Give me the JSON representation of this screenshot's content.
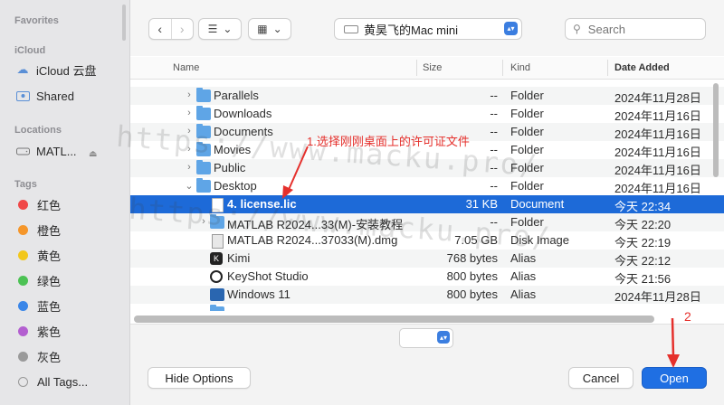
{
  "sidebar": {
    "favorites_heading": "Favorites",
    "icloud_heading": "iCloud",
    "icloud_items": [
      {
        "label": "iCloud 云盘",
        "icon": "cloud-icon"
      },
      {
        "label": "Shared",
        "icon": "shared-folder-icon"
      }
    ],
    "locations_heading": "Locations",
    "location_items": [
      {
        "label": "MATL...",
        "icon": "disk-icon"
      }
    ],
    "tags_heading": "Tags",
    "tags": [
      {
        "label": "红色",
        "color": "#f04848"
      },
      {
        "label": "橙色",
        "color": "#f5962a"
      },
      {
        "label": "黄色",
        "color": "#f2c71b"
      },
      {
        "label": "绿色",
        "color": "#4cc254"
      },
      {
        "label": "蓝色",
        "color": "#3a86e8"
      },
      {
        "label": "紫色",
        "color": "#b35fd0"
      },
      {
        "label": "灰色",
        "color": "#9a9a9a"
      }
    ],
    "all_tags_label": "All Tags..."
  },
  "toolbar": {
    "back_glyph": "‹",
    "forward_glyph": "›",
    "list_view_glyph": "☰",
    "grid_view_glyph": "▦",
    "dropdown_glyph": "⌄",
    "location_label": "黄昊飞的Mac mini",
    "search_placeholder": "Search"
  },
  "columns": {
    "name": "Name",
    "size": "Size",
    "kind": "Kind",
    "date_added": "Date Added"
  },
  "rows": [
    {
      "name": "Parallels",
      "size": "--",
      "kind": "Folder",
      "date": "2024年11月28日",
      "level": 1,
      "icon": "folder-icon",
      "expandable": true,
      "expanded": false
    },
    {
      "name": "Downloads",
      "size": "--",
      "kind": "Folder",
      "date": "2024年11月16日",
      "level": 1,
      "icon": "folder-icon",
      "expandable": true,
      "expanded": false
    },
    {
      "name": "Documents",
      "size": "--",
      "kind": "Folder",
      "date": "2024年11月16日",
      "level": 1,
      "icon": "folder-icon",
      "expandable": true,
      "expanded": false
    },
    {
      "name": "Movies",
      "size": "--",
      "kind": "Folder",
      "date": "2024年11月16日",
      "level": 1,
      "icon": "folder-icon",
      "expandable": true,
      "expanded": false
    },
    {
      "name": "Public",
      "size": "--",
      "kind": "Folder",
      "date": "2024年11月16日",
      "level": 1,
      "icon": "folder-icon",
      "expandable": true,
      "expanded": false
    },
    {
      "name": "Desktop",
      "size": "--",
      "kind": "Folder",
      "date": "2024年11月16日",
      "level": 1,
      "icon": "folder-icon",
      "expandable": true,
      "expanded": true
    },
    {
      "name": "4. license.lic",
      "size": "31 KB",
      "kind": "Document",
      "date": "今天 22:34",
      "level": 2,
      "icon": "document-icon",
      "expandable": false,
      "selected": true
    },
    {
      "name": "MATLAB R2024...33(M)-安装教程",
      "size": "--",
      "kind": "Folder",
      "date": "今天 22:20",
      "level": 2,
      "icon": "folder-icon",
      "expandable": true,
      "expanded": false
    },
    {
      "name": "MATLAB R2024...37033(M).dmg",
      "size": "7.05 GB",
      "kind": "Disk Image",
      "date": "今天 22:19",
      "level": 2,
      "icon": "disk-image-icon",
      "expandable": false
    },
    {
      "name": "Kimi",
      "size": "768 bytes",
      "kind": "Alias",
      "date": "今天 22:12",
      "level": 2,
      "icon": "kimi-alias-icon",
      "expandable": false
    },
    {
      "name": "KeyShot Studio",
      "size": "800 bytes",
      "kind": "Alias",
      "date": "今天 21:56",
      "level": 2,
      "icon": "keyshot-alias-icon",
      "expandable": false
    },
    {
      "name": "Windows 11",
      "size": "800 bytes",
      "kind": "Alias",
      "date": "2024年11月28日",
      "level": 2,
      "icon": "windows-alias-icon",
      "expandable": false
    }
  ],
  "footer": {
    "hide_options_label": "Hide Options",
    "cancel_label": "Cancel",
    "open_label": "Open"
  },
  "annotations": {
    "step1": "1.选择刚刚桌面上的许可证文件",
    "step2": "2"
  },
  "watermark": "https://www.macku.pro/",
  "colors": {
    "selection": "#1d6ad8",
    "primary_button": "#1f6fe3",
    "annotation": "#e5302c"
  }
}
